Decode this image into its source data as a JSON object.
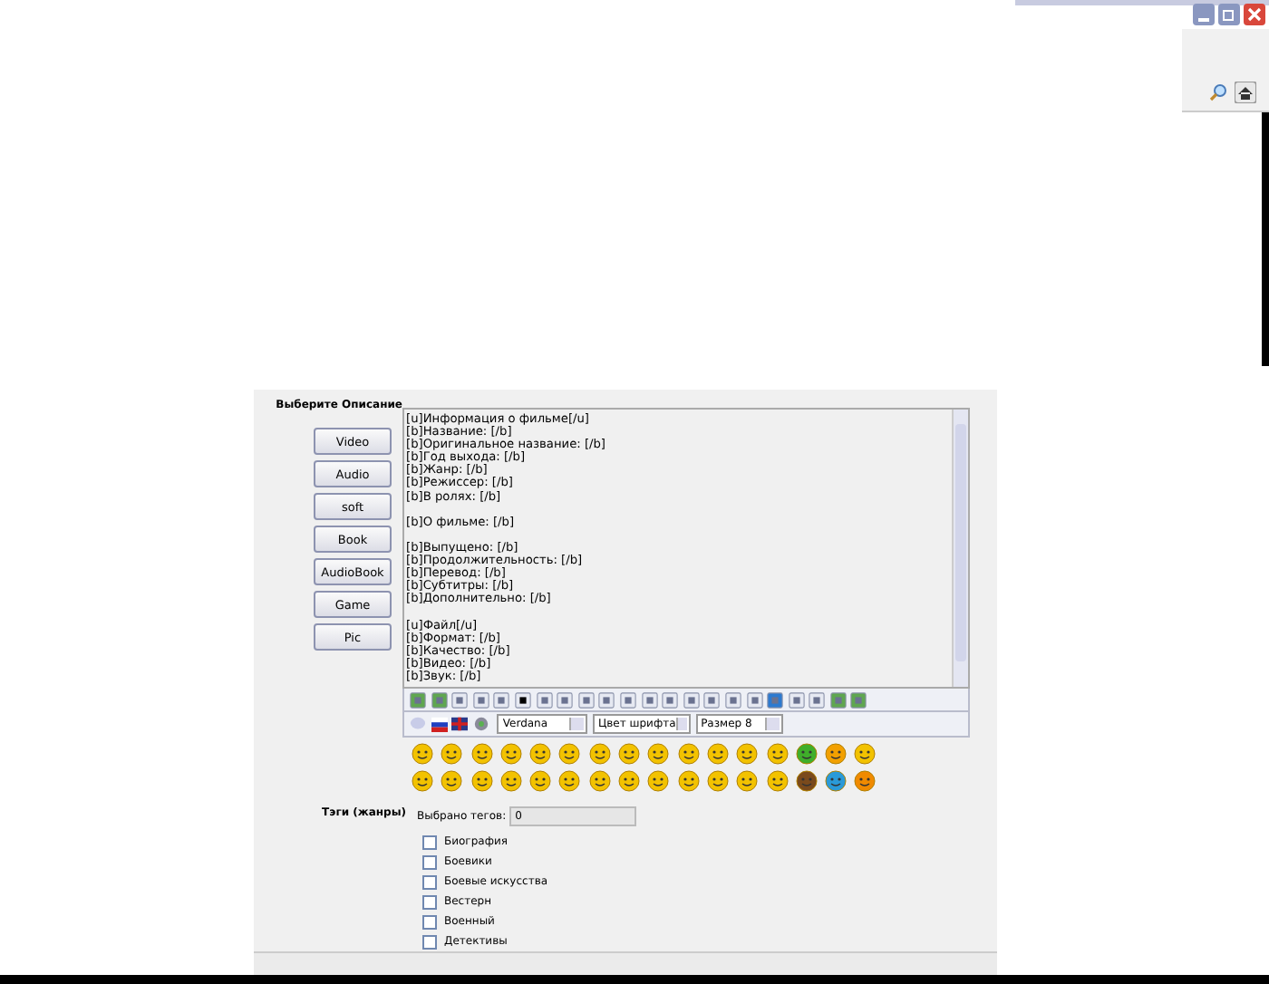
{
  "form": {
    "description_label": "Выберите Описание",
    "type_buttons": [
      "Video",
      "Audio",
      "soft",
      "Book",
      "AudioBook",
      "Game",
      "Pic"
    ],
    "description_blocks": [
      [
        "[u]Информация о фильме[/u]",
        "[b]Название: [/b]",
        "[b]Оригинальное название: [/b]",
        "[b]Год выхода: [/b]",
        "[b]Жанр: [/b]",
        "[b]Режиссер: [/b]",
        "[b]В ролях: [/b]"
      ],
      [
        "[b]О фильме: [/b]"
      ],
      [
        "[b]Выпущено: [/b]",
        "[b]Продолжительность: [/b]",
        "[b]Перевод: [/b]",
        "[b]Субтитры: [/b]",
        "[b]Дополнительно: [/b]"
      ],
      [
        "[u]Файл[/u]",
        "[b]Формат: [/b]",
        "[b]Качество: [/b]",
        "[b]Видео: [/b]",
        "[b]Звук: [/b]"
      ]
    ],
    "font_select": "Verdana",
    "color_select": "Цвет шрифта",
    "size_select": "Размер 8",
    "tags_label": "Тэги (жанры)",
    "tags_count_label": "Выбрано тегов:",
    "tags_count_value": "0",
    "tags": [
      {
        "label": "Биография",
        "checked": false
      },
      {
        "label": "Боевики",
        "checked": false
      },
      {
        "label": "Боевые искусства",
        "checked": false
      },
      {
        "label": "Вестерн",
        "checked": false
      },
      {
        "label": "Военный",
        "checked": false
      },
      {
        "label": "Детективы",
        "checked": false
      }
    ]
  }
}
